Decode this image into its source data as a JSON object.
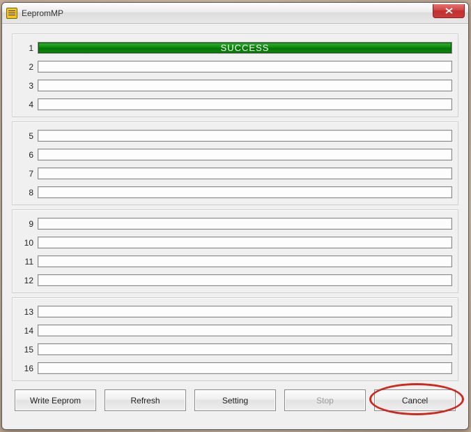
{
  "window": {
    "title": "EepromMP"
  },
  "groups": [
    {
      "rows": [
        {
          "index": "1",
          "status": "SUCCESS",
          "filled": true
        },
        {
          "index": "2",
          "status": "",
          "filled": false
        },
        {
          "index": "3",
          "status": "",
          "filled": false
        },
        {
          "index": "4",
          "status": "",
          "filled": false
        }
      ]
    },
    {
      "rows": [
        {
          "index": "5",
          "status": "",
          "filled": false
        },
        {
          "index": "6",
          "status": "",
          "filled": false
        },
        {
          "index": "7",
          "status": "",
          "filled": false
        },
        {
          "index": "8",
          "status": "",
          "filled": false
        }
      ]
    },
    {
      "rows": [
        {
          "index": "9",
          "status": "",
          "filled": false
        },
        {
          "index": "10",
          "status": "",
          "filled": false
        },
        {
          "index": "11",
          "status": "",
          "filled": false
        },
        {
          "index": "12",
          "status": "",
          "filled": false
        }
      ]
    },
    {
      "rows": [
        {
          "index": "13",
          "status": "",
          "filled": false
        },
        {
          "index": "14",
          "status": "",
          "filled": false
        },
        {
          "index": "15",
          "status": "",
          "filled": false
        },
        {
          "index": "16",
          "status": "",
          "filled": false
        }
      ]
    }
  ],
  "buttons": {
    "write": "Write Eeprom",
    "refresh": "Refresh",
    "setting": "Setting",
    "stop": "Stop",
    "cancel": "Cancel"
  },
  "colors": {
    "success_bg": "#0a850a",
    "highlight": "#cc2a1f"
  }
}
